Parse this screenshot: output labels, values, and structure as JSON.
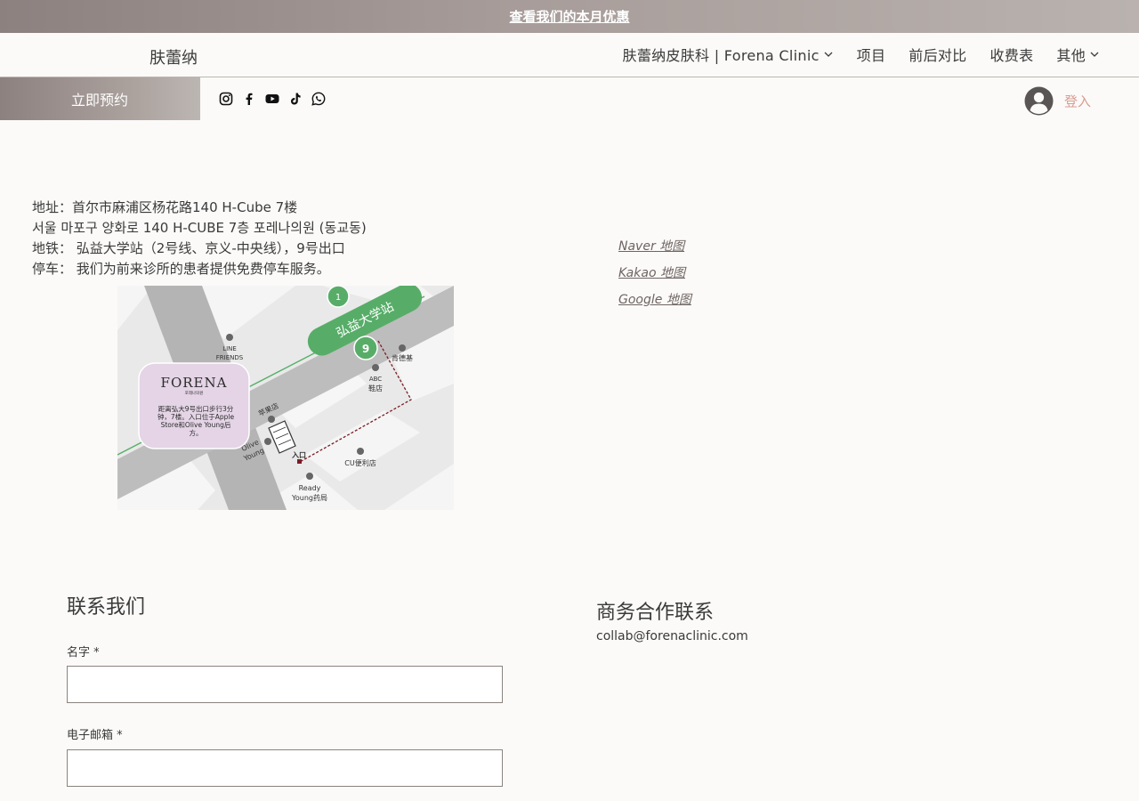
{
  "promo": {
    "text": "查看我们的本月优惠"
  },
  "header": {
    "brand": "肤蕾纳",
    "nav": [
      {
        "label": "肤蕾纳皮肤科 | Forena Clinic",
        "has_dropdown": true
      },
      {
        "label": "项目",
        "has_dropdown": false
      },
      {
        "label": "前后对比",
        "has_dropdown": false
      },
      {
        "label": "收费表",
        "has_dropdown": false
      },
      {
        "label": "其他",
        "has_dropdown": true
      }
    ]
  },
  "subbar": {
    "book_label": "立即预约",
    "socials": [
      "instagram-icon",
      "facebook-icon",
      "youtube-icon",
      "tiktok-icon",
      "whatsapp-icon"
    ],
    "login_label": "登入"
  },
  "address": {
    "line1": "地址：首尔市麻浦区杨花路140 H-Cube 7楼",
    "line2": "서울 마포구 양화로 140 H-CUBE 7층 포레나의원 (동교동)",
    "line3": "地铁： 弘益大学站（2号线、京义-中央线），9号出口",
    "line4": "停车： 我们为前来诊所的患者提供免费停车服务。"
  },
  "map_links": [
    {
      "label": "Naver 地图"
    },
    {
      "label": "Kakao 地图"
    },
    {
      "label": "Google 地图"
    }
  ],
  "map": {
    "station": "弘益大学站",
    "exit_badge": "1",
    "exit_nine": "9",
    "poi_line_friends_1": "LINE",
    "poi_line_friends_2": "FRIENDS",
    "poi_kfc": "肯德基",
    "poi_abc_1": "ABC",
    "poi_abc_2": "鞋店",
    "poi_apple": "苹果店",
    "poi_olive_1": "Olive",
    "poi_olive_2": "Young",
    "poi_entrance": "入口",
    "poi_cu": "CU便利店",
    "poi_ready_1": "Ready",
    "poi_ready_2": "Young药局",
    "logo_text": "FORENA",
    "logo_sub": "포레나의원",
    "card_line1": "距离弘大9号出口步行3分",
    "card_line2": "钟，7楼。入口位于Apple",
    "card_line3": "Store和Olive Young后",
    "card_line4": "方。"
  },
  "contact": {
    "title": "联系我们",
    "name_label": "名字 *",
    "email_label": "电子邮箱 *"
  },
  "business": {
    "title": "商务合作联系",
    "email": "collab@forenaclinic.com"
  },
  "colors": {
    "accent_gradient_start": "#8d8180",
    "accent_gradient_end": "#bcb6b2",
    "login_text": "#d89c92",
    "map_green": "#57ad68",
    "card_lavender": "#e4d4e6"
  }
}
